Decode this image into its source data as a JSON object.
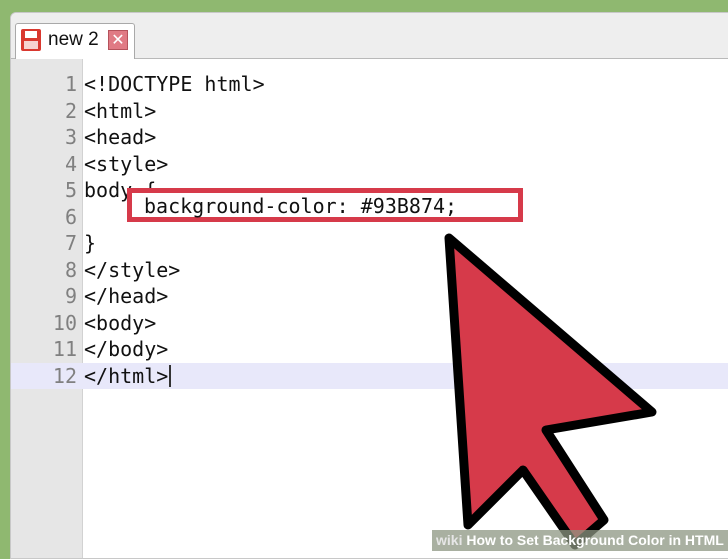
{
  "tab": {
    "label": "new 2",
    "close_glyph": "✕"
  },
  "lines": [
    {
      "num": "1",
      "text": "<!DOCTYPE html>"
    },
    {
      "num": "2",
      "text": "<html>"
    },
    {
      "num": "3",
      "text": "<head>"
    },
    {
      "num": "4",
      "text": "<style>"
    },
    {
      "num": "5",
      "text": "body {"
    },
    {
      "num": "6",
      "text": ""
    },
    {
      "num": "7",
      "text": "}"
    },
    {
      "num": "8",
      "text": "</style>"
    },
    {
      "num": "9",
      "text": "</head>"
    },
    {
      "num": "10",
      "text": "<body>"
    },
    {
      "num": "11",
      "text": "</body>"
    },
    {
      "num": "12",
      "text": "</html>"
    }
  ],
  "highlight": {
    "text": "background-color: #93B874;"
  },
  "watermark": {
    "prefix": "wiki",
    "text": "How to Set Background Color in HTML"
  },
  "colors": {
    "background": "#93B874",
    "arrow": "#d63a4a",
    "highlight_border": "#d63a4a"
  },
  "icons": {
    "save": "save-icon",
    "close": "close-icon",
    "arrow": "pointer-arrow-icon"
  }
}
